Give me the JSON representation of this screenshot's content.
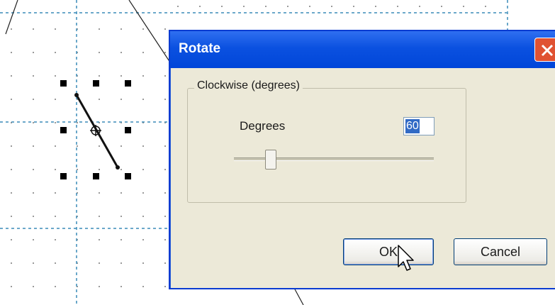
{
  "dialog": {
    "title": "Rotate",
    "group_label": "Clockwise (degrees)",
    "degrees_label": "Degrees",
    "degrees_value": "60",
    "slider_value": 60,
    "ok_label": "OK",
    "cancel_label": "Cancel"
  },
  "icons": {
    "close": "close-icon",
    "cursor": "mouse-pointer-icon",
    "rotation_center": "rotation-center-icon"
  },
  "colors": {
    "titlebar": "#0b51e0",
    "close_button": "#e05232",
    "dialog_bg": "#ece9d8",
    "selection": "#316ac5",
    "guide_lines": "#3a8bb8"
  }
}
